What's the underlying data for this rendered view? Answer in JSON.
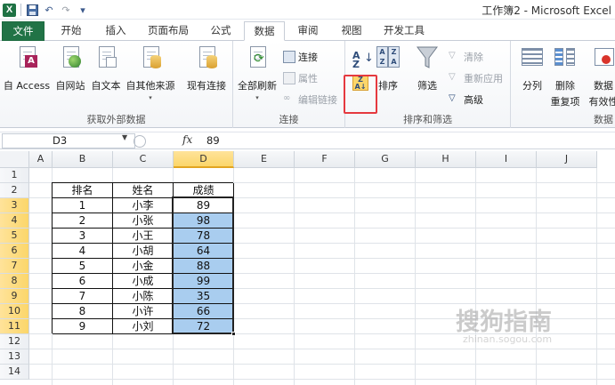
{
  "title": "工作簿2 - Microsoft Excel",
  "qat": {
    "icons": [
      "excel-logo",
      "save-icon",
      "undo-icon",
      "redo-icon",
      "customize-icon"
    ]
  },
  "tabs": [
    "文件",
    "开始",
    "插入",
    "页面布局",
    "公式",
    "数据",
    "审阅",
    "视图",
    "开发工具"
  ],
  "active_tab": "数据",
  "ribbon": {
    "get_external": {
      "label": "获取外部数据",
      "buttons": [
        "自 Access",
        "自网站",
        "自文本",
        "自其他来源",
        "现有连接"
      ]
    },
    "connections": {
      "label": "连接",
      "refresh_all": "全部刷新",
      "connection": "连接",
      "properties": "属性",
      "edit_links": "编辑链接"
    },
    "sort_filter": {
      "label": "排序和筛选",
      "sort": "排序",
      "filter": "筛选",
      "clear": "清除",
      "reapply": "重新应用",
      "advanced": "高级"
    },
    "data_tools": {
      "label": "数据",
      "text_to_columns": "分列",
      "remove_duplicates_1": "删除",
      "remove_duplicates_2": "重复项",
      "validation_1": "数据",
      "validation_2": "有效性"
    }
  },
  "formula_bar": {
    "name_box": "D3",
    "fx": "fx",
    "value": "89"
  },
  "columns": [
    "A",
    "B",
    "C",
    "D",
    "E",
    "F",
    "G",
    "H",
    "I",
    "J"
  ],
  "rows": [
    "1",
    "2",
    "3",
    "4",
    "5",
    "6",
    "7",
    "8",
    "9",
    "10",
    "11",
    "12",
    "13",
    "14"
  ],
  "table": {
    "headers": [
      "排名",
      "姓名",
      "成绩"
    ],
    "rows": [
      [
        "1",
        "小李",
        "89"
      ],
      [
        "2",
        "小张",
        "98"
      ],
      [
        "3",
        "小王",
        "78"
      ],
      [
        "4",
        "小胡",
        "64"
      ],
      [
        "5",
        "小金",
        "88"
      ],
      [
        "6",
        "小成",
        "99"
      ],
      [
        "7",
        "小陈",
        "35"
      ],
      [
        "8",
        "小许",
        "66"
      ],
      [
        "9",
        "小刘",
        "72"
      ]
    ]
  },
  "colors": {
    "file_tab": "#217346",
    "selection": "#a9cdef",
    "header_selected": "#fbd66a",
    "highlight": "#e5393f"
  },
  "watermark": {
    "main": "搜狗指南",
    "sub": "zhinan.sogou.com"
  }
}
